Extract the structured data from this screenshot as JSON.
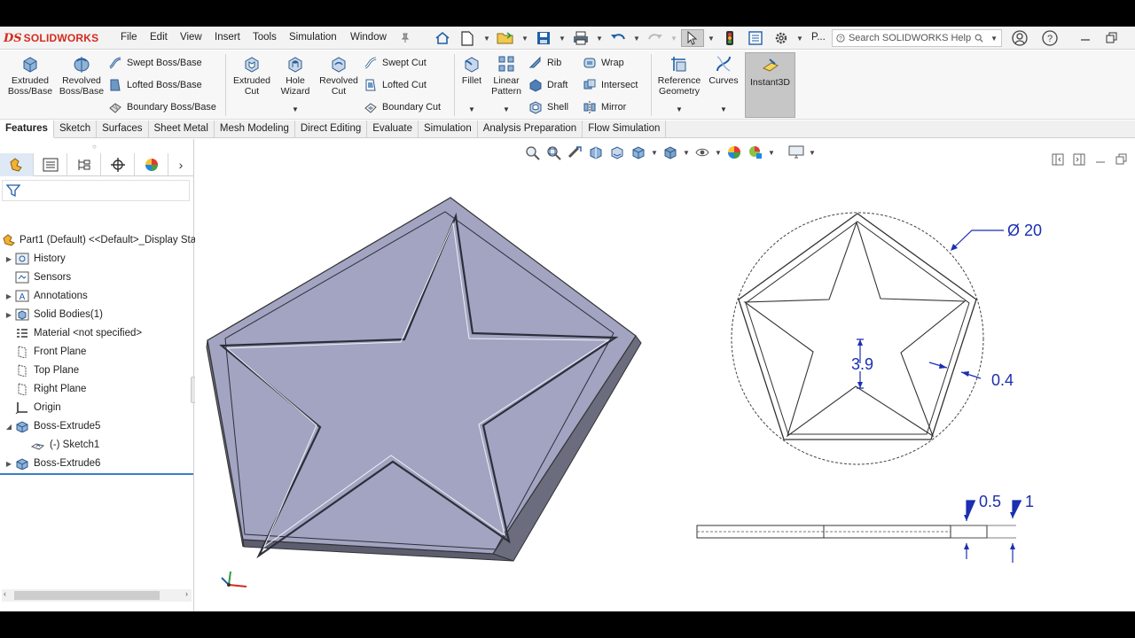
{
  "app": {
    "brand": "SOLIDWORKS",
    "brand_mark": "DS",
    "menu": [
      "File",
      "Edit",
      "View",
      "Insert",
      "Tools",
      "Simulation",
      "Window"
    ],
    "truncated_label": "P...",
    "search_placeholder": "Search SOLIDWORKS Help"
  },
  "commands": {
    "extruded_boss": "Extruded\nBoss/Base",
    "revolved_boss": "Revolved\nBoss/Base",
    "swept_boss": "Swept Boss/Base",
    "lofted_boss": "Lofted Boss/Base",
    "boundary_boss": "Boundary Boss/Base",
    "extruded_cut": "Extruded\nCut",
    "hole_wizard": "Hole\nWizard",
    "revolved_cut": "Revolved\nCut",
    "swept_cut": "Swept Cut",
    "lofted_cut": "Lofted Cut",
    "boundary_cut": "Boundary Cut",
    "fillet": "Fillet",
    "linear_pattern": "Linear\nPattern",
    "rib": "Rib",
    "draft": "Draft",
    "shell": "Shell",
    "wrap": "Wrap",
    "intersect": "Intersect",
    "mirror": "Mirror",
    "reference_geometry": "Reference\nGeometry",
    "curves": "Curves",
    "instant3d": "Instant3D"
  },
  "tabs": [
    "Features",
    "Sketch",
    "Surfaces",
    "Sheet Metal",
    "Mesh Modeling",
    "Direct Editing",
    "Evaluate",
    "Simulation",
    "Analysis Preparation",
    "Flow Simulation"
  ],
  "tree": {
    "root": "Part1 (Default) <<Default>_Display Sta",
    "items": [
      {
        "label": "History",
        "expandable": true
      },
      {
        "label": "Sensors",
        "expandable": false
      },
      {
        "label": "Annotations",
        "expandable": true
      },
      {
        "label": "Solid Bodies(1)",
        "expandable": true
      },
      {
        "label": "Material <not specified>",
        "expandable": false
      },
      {
        "label": "Front Plane",
        "expandable": false
      },
      {
        "label": "Top Plane",
        "expandable": false
      },
      {
        "label": "Right Plane",
        "expandable": false
      },
      {
        "label": "Origin",
        "expandable": false
      },
      {
        "label": "Boss-Extrude5",
        "expandable": true
      },
      {
        "label": "(-) Sketch1",
        "expandable": false
      },
      {
        "label": "Boss-Extrude6",
        "expandable": true
      }
    ]
  },
  "drawing": {
    "diameter": "Ø 20",
    "star_depth": "3.9",
    "offset": "0.4",
    "groove": "0.5",
    "thickness": "1"
  },
  "colors": {
    "brand": "#d42a1e",
    "model_face": "#a2a4c2",
    "model_side": "#6b6d7e",
    "dimension": "#1b2fb0"
  }
}
